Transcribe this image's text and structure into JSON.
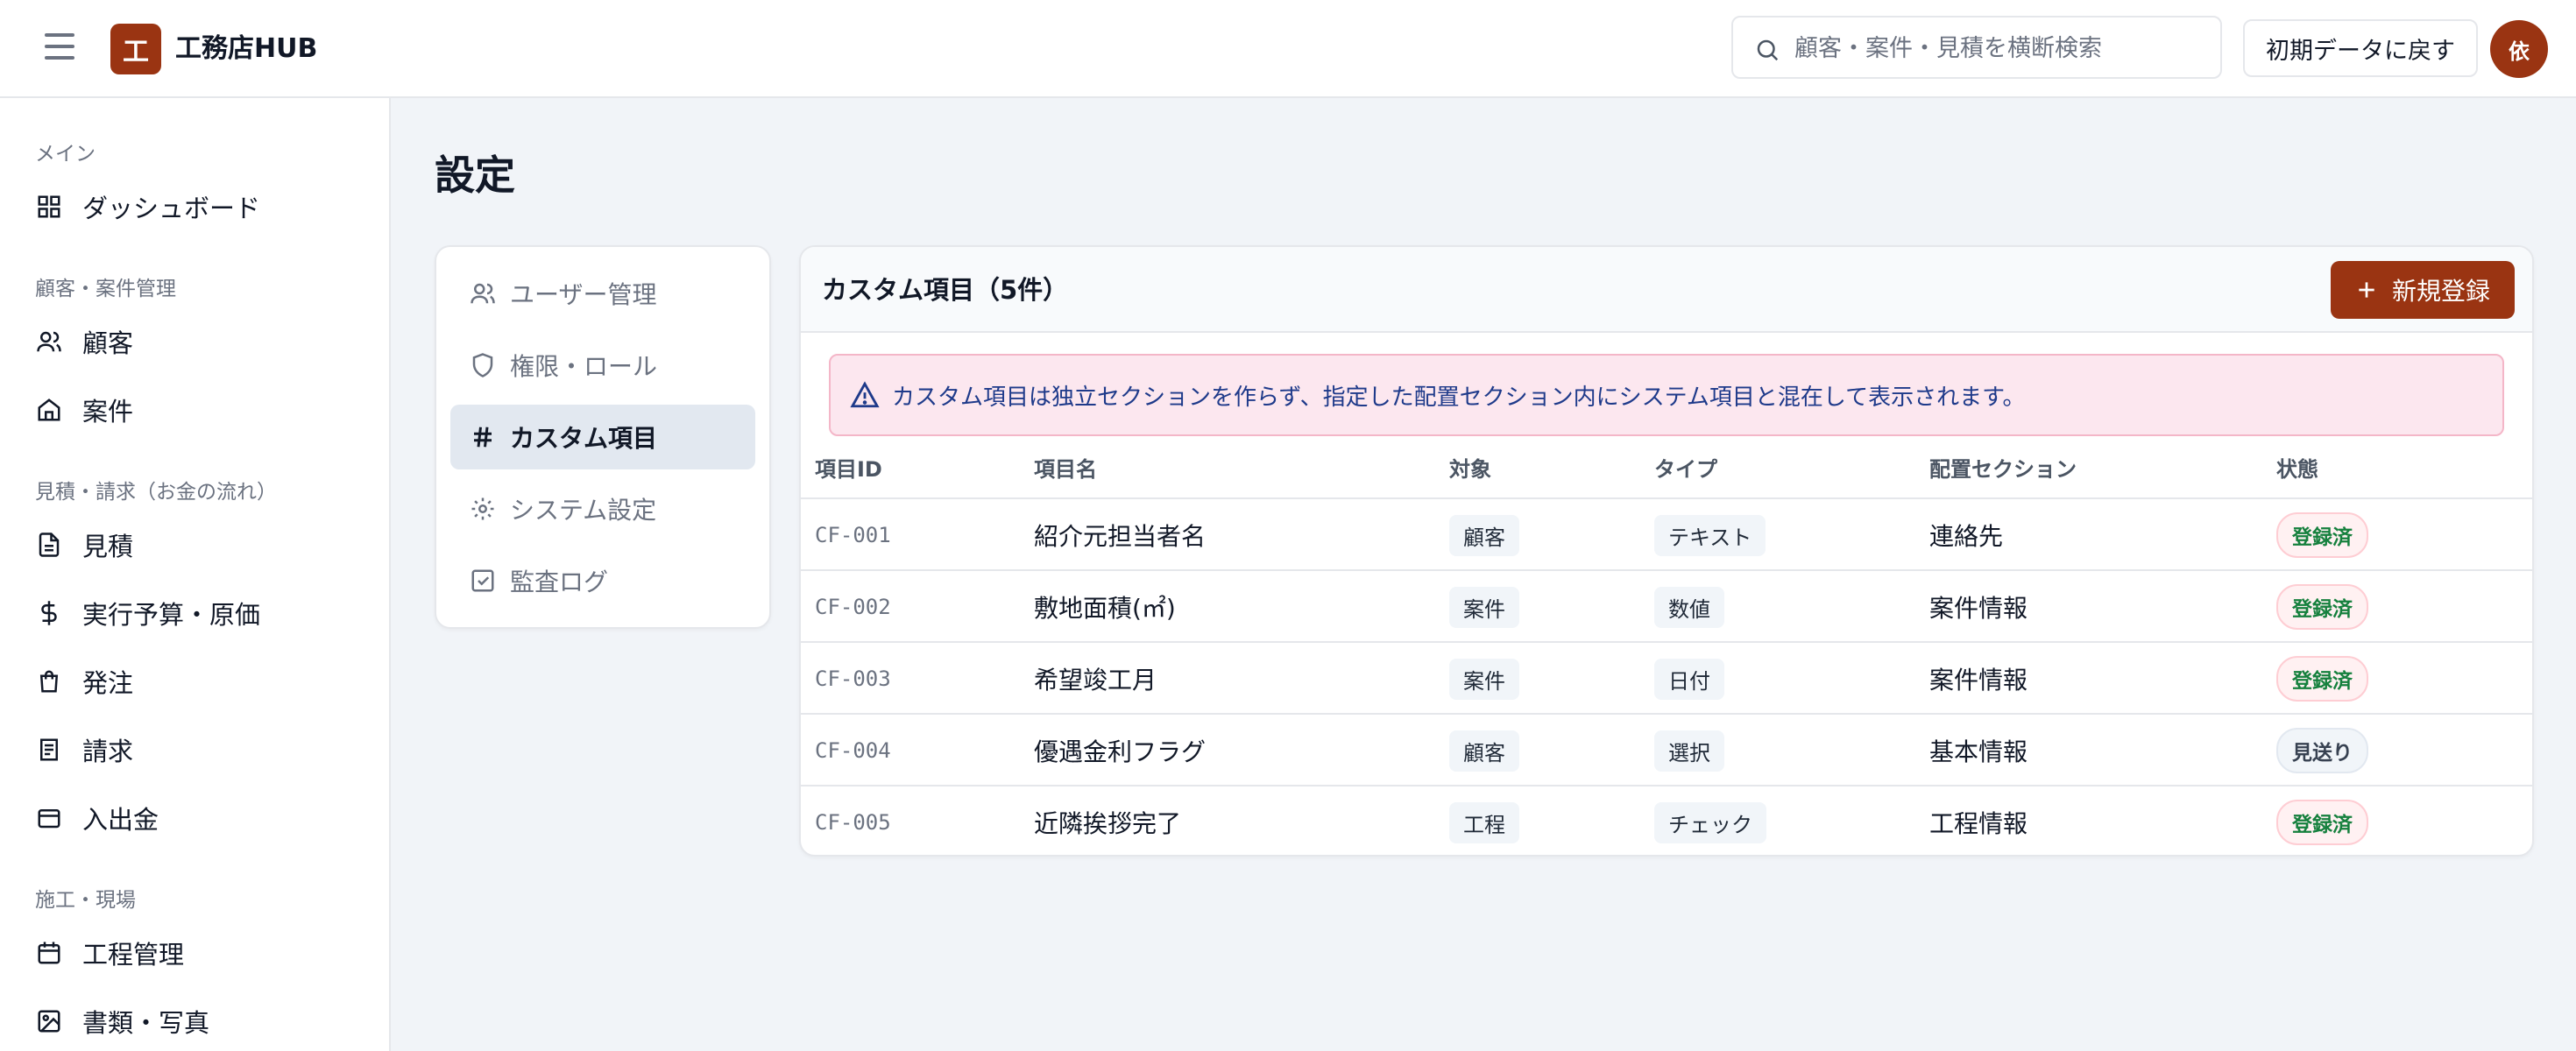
{
  "app": {
    "logo_char": "工",
    "name": "工務店HUB"
  },
  "header": {
    "search_placeholder": "顧客・案件・見積を横断検索",
    "reset_label": "初期データに戻す",
    "avatar_label": "依"
  },
  "sidebar": {
    "sections": [
      {
        "title": "メイン",
        "items": [
          {
            "label": "ダッシュボード",
            "icon": "dashboard-icon"
          }
        ]
      },
      {
        "title": "顧客・案件管理",
        "items": [
          {
            "label": "顧客",
            "icon": "users-icon"
          },
          {
            "label": "案件",
            "icon": "home-icon"
          }
        ]
      },
      {
        "title": "見積・請求（お金の流れ）",
        "items": [
          {
            "label": "見積",
            "icon": "document-icon"
          },
          {
            "label": "実行予算・原価",
            "icon": "dollar-icon"
          },
          {
            "label": "発注",
            "icon": "bag-icon"
          },
          {
            "label": "請求",
            "icon": "receipt-icon"
          },
          {
            "label": "入出金",
            "icon": "wallet-icon"
          }
        ]
      },
      {
        "title": "施工・現場",
        "items": [
          {
            "label": "工程管理",
            "icon": "calendar-icon"
          },
          {
            "label": "書類・写真",
            "icon": "image-icon"
          }
        ]
      }
    ]
  },
  "page": {
    "title": "設定"
  },
  "settings_nav": [
    {
      "label": "ユーザー管理",
      "icon": "users-icon"
    },
    {
      "label": "権限・ロール",
      "icon": "shield-icon"
    },
    {
      "label": "カスタム項目",
      "icon": "hash-icon",
      "active": true
    },
    {
      "label": "システム設定",
      "icon": "gear-icon"
    },
    {
      "label": "監査ログ",
      "icon": "checkbox-icon"
    }
  ],
  "custom_fields": {
    "title": "カスタム項目（5件）",
    "new_label": "新規登録",
    "notice": "カスタム項目は独立セクションを作らず、指定した配置セクション内にシステム項目と混在して表示されます。",
    "columns": [
      "項目ID",
      "項目名",
      "対象",
      "タイプ",
      "配置セクション",
      "状態"
    ],
    "rows": [
      {
        "id": "CF-001",
        "name": "紹介元担当者名",
        "target": "顧客",
        "type": "テキスト",
        "section": "連絡先",
        "status": "登録済",
        "active": true
      },
      {
        "id": "CF-002",
        "name": "敷地面積(㎡)",
        "target": "案件",
        "type": "数値",
        "section": "案件情報",
        "status": "登録済",
        "active": true
      },
      {
        "id": "CF-003",
        "name": "希望竣工月",
        "target": "案件",
        "type": "日付",
        "section": "案件情報",
        "status": "登録済",
        "active": true
      },
      {
        "id": "CF-004",
        "name": "優遇金利フラグ",
        "target": "顧客",
        "type": "選択",
        "section": "基本情報",
        "status": "見送り",
        "active": false
      },
      {
        "id": "CF-005",
        "name": "近隣挨拶完了",
        "target": "工程",
        "type": "チェック",
        "section": "工程情報",
        "status": "登録済",
        "active": true
      }
    ]
  },
  "colors": {
    "brand": "#9a3412",
    "status_ok": "#15803d",
    "notice_bg": "#fce7ef",
    "notice_text": "#1e3a8a"
  }
}
